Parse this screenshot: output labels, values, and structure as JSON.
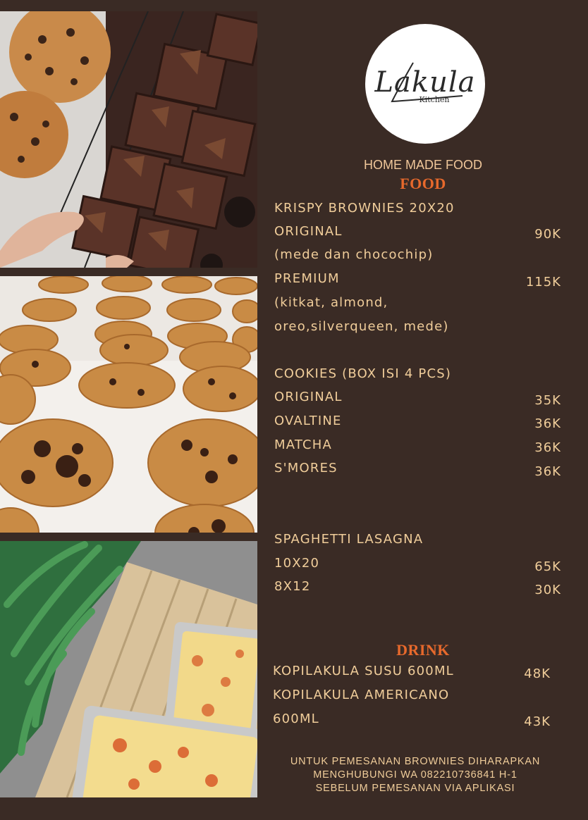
{
  "brand": {
    "logo_script": "Lakula",
    "logo_sub": "Kitchen",
    "tagline": "HOME MADE FOOD"
  },
  "sections": {
    "food_title": "FOOD",
    "drink_title": "DRINK"
  },
  "brownies": {
    "heading": "KRISPY BROWNIES 20X20",
    "original": {
      "label": "ORIGINAL",
      "price": "90K",
      "desc": "(mede dan chocochip)"
    },
    "premium": {
      "label": "PREMIUM",
      "price": "115K",
      "desc_1": "(kitkat, almond,",
      "desc_2": "oreo,silverqueen, mede)"
    }
  },
  "cookies": {
    "heading": "COOKIES (BOX ISI 4 PCS)",
    "items": [
      {
        "label": "ORIGINAL",
        "price": "35K"
      },
      {
        "label": "OVALTINE",
        "price": "36K"
      },
      {
        "label": "MATCHA",
        "price": "36K"
      },
      {
        "label": "S'MORES",
        "price": "36K"
      }
    ]
  },
  "lasagna": {
    "heading": "SPAGHETTI LASAGNA",
    "items": [
      {
        "label": "10X20",
        "price": "65K"
      },
      {
        "label": "8X12",
        "price": "30K"
      }
    ]
  },
  "drinks": {
    "item_1": {
      "label": "KOPILAKULA SUSU 600ML",
      "price": "48K"
    },
    "item_2": {
      "label_1": "KOPILAKULA AMERICANO",
      "label_2": "600ML",
      "price": "43K"
    }
  },
  "note": {
    "line_1": "UNTUK PEMESANAN BROWNIES DIHARAPKAN",
    "line_2": "MENGHUBUNGI WA 082210736841 H-1",
    "line_3": "SEBELUM PEMESANAN VIA APLIKASI"
  },
  "colors": {
    "background": "#3a2b25",
    "text": "#f0cd9a",
    "accent": "#e7692c"
  }
}
